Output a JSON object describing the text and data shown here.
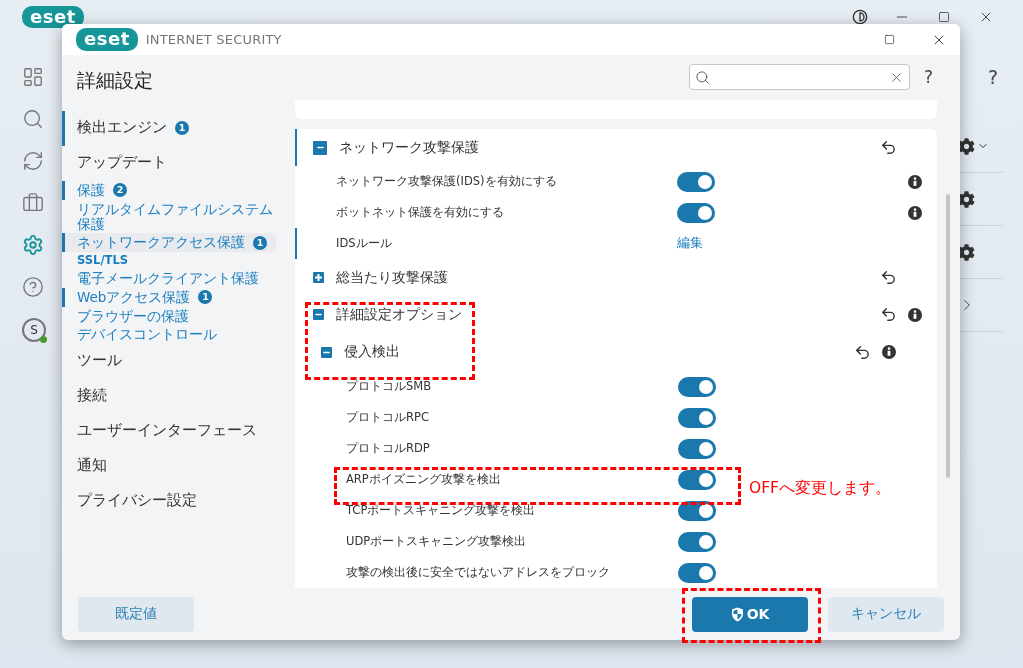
{
  "app": {
    "logo": "eset",
    "help": "?",
    "avatar": "S"
  },
  "dialog": {
    "logo": "eset",
    "product": "INTERNET SECURITY",
    "title": "詳細設定",
    "help": "?"
  },
  "sidebar": {
    "items": [
      {
        "label": "検出エンジン",
        "kind": "category",
        "badge": "1",
        "changed": true,
        "selected": false
      },
      {
        "label": "アップデート",
        "kind": "category",
        "changed": false,
        "selected": false
      },
      {
        "label": "保護",
        "kind": "group",
        "badge": "2",
        "changed": true,
        "selected": false
      },
      {
        "label": "リアルタイムファイルシステム保護",
        "kind": "sub",
        "changed": false,
        "selected": false
      },
      {
        "label": "ネットワークアクセス保護",
        "kind": "sub",
        "badge": "1",
        "changed": true,
        "selected": true
      },
      {
        "label": "SSL/TLS",
        "kind": "small",
        "changed": false,
        "selected": false
      },
      {
        "label": "電子メールクライアント保護",
        "kind": "sub",
        "changed": false,
        "selected": false
      },
      {
        "label": "Webアクセス保護",
        "kind": "sub",
        "badge": "1",
        "changed": true,
        "selected": false
      },
      {
        "label": "ブラウザーの保護",
        "kind": "sub",
        "changed": false,
        "selected": false
      },
      {
        "label": "デバイスコントロール",
        "kind": "sub",
        "changed": false,
        "selected": false
      },
      {
        "label": "ツール",
        "kind": "category",
        "changed": false,
        "selected": false
      },
      {
        "label": "接続",
        "kind": "category",
        "changed": false,
        "selected": false
      },
      {
        "label": "ユーザーインターフェース",
        "kind": "category",
        "changed": false,
        "selected": false
      },
      {
        "label": "通知",
        "kind": "category",
        "changed": false,
        "selected": false
      },
      {
        "label": "プライバシー設定",
        "kind": "category",
        "changed": false,
        "selected": false
      }
    ]
  },
  "sections": [
    {
      "title": "ネットワーク攻撃保護",
      "expanded": true,
      "changed": true,
      "info": false,
      "rows": [
        {
          "kind": "toggle",
          "label": "ネットワーク攻撃保護(IDS)を有効にする",
          "on": true,
          "info": true,
          "changed": false
        },
        {
          "kind": "toggle",
          "label": "ボットネット保護を有効にする",
          "on": true,
          "info": true,
          "changed": false
        },
        {
          "kind": "link",
          "label": "IDSルール",
          "link": "編集",
          "info": false,
          "changed": true
        }
      ]
    },
    {
      "title": "総当たり攻撃保護",
      "expanded": false,
      "changed": false,
      "info": false
    },
    {
      "title": "詳細設定オプション",
      "expanded": true,
      "changed": false,
      "info": true,
      "children": [
        {
          "title": "侵入検出",
          "expanded": true,
          "changed": false,
          "info": true,
          "rows": [
            {
              "kind": "toggle",
              "label": "プロトコルSMB",
              "on": true,
              "info": false,
              "changed": false
            },
            {
              "kind": "toggle",
              "label": "プロトコルRPC",
              "on": true,
              "info": false,
              "changed": false
            },
            {
              "kind": "toggle",
              "label": "プロトコルRDP",
              "on": true,
              "info": false,
              "changed": false
            },
            {
              "kind": "toggle",
              "label": "ARPポイズニング攻撃を検出",
              "on": true,
              "info": false,
              "changed": false
            },
            {
              "kind": "toggle",
              "label": "TCPポートスキャニング攻撃を検出",
              "on": true,
              "info": false,
              "changed": false
            },
            {
              "kind": "toggle",
              "label": "UDPポートスキャニング攻撃検出",
              "on": true,
              "info": false,
              "changed": false
            },
            {
              "kind": "toggle",
              "label": "攻撃の検出後に安全ではないアドレスをブロック",
              "on": true,
              "info": false,
              "changed": false
            }
          ]
        }
      ]
    }
  ],
  "footer": {
    "default_button": "既定値",
    "ok_button": "OK",
    "cancel_button": "キャンセル"
  },
  "annotation": {
    "note": "OFFへ変更します。"
  }
}
